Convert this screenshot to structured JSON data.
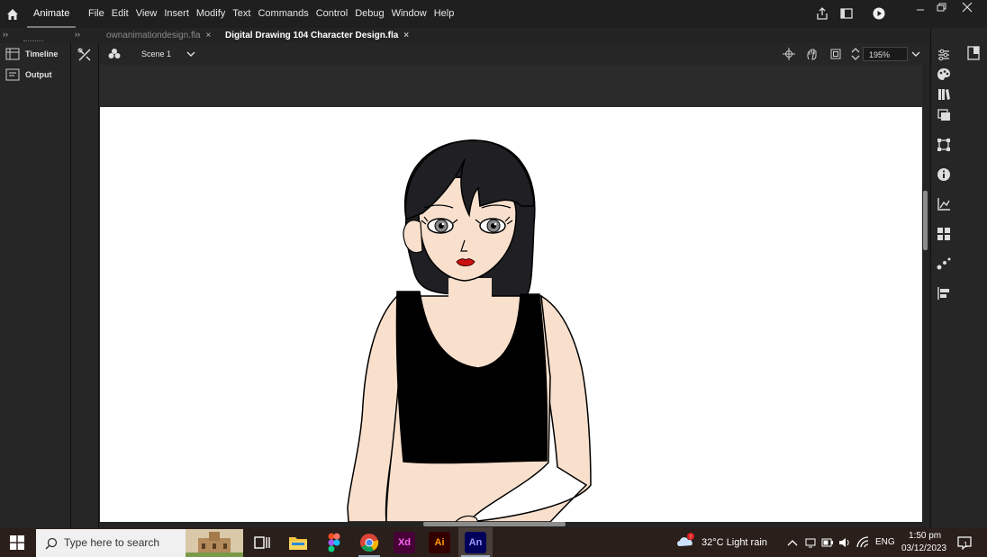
{
  "menubar": {
    "app_name": "Animate",
    "menus": [
      "File",
      "Edit",
      "View",
      "Insert",
      "Modify",
      "Text",
      "Commands",
      "Control",
      "Debug",
      "Window",
      "Help"
    ]
  },
  "tabs": [
    {
      "label": "ownanimationdesign.fla",
      "active": false
    },
    {
      "label": "Digital Drawing 104  Character Design.fla",
      "active": true
    }
  ],
  "left_panel": {
    "items": [
      "Timeline",
      "Output"
    ]
  },
  "scene_bar": {
    "scene_label": "Scene 1",
    "zoom": "195%"
  },
  "taskbar": {
    "search_placeholder": "Type here to search",
    "apps": [
      "Xd",
      "Ai",
      "An"
    ],
    "weather": "32°C  Light rain",
    "language": "ENG",
    "time": "1:50 pm",
    "date": "03/12/2023",
    "notification_count": "1"
  },
  "colors": {
    "hair": "#202024",
    "skin": "#f9e0cd",
    "top": "#000000",
    "lips": "#cc1111"
  }
}
